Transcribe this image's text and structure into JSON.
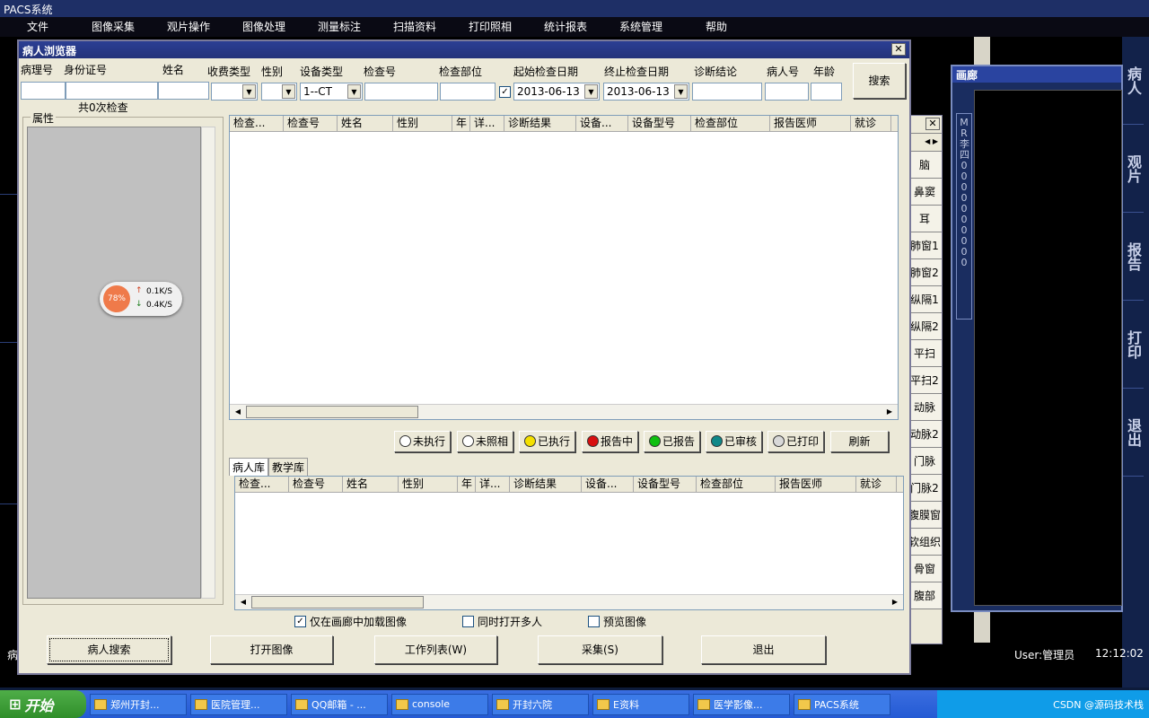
{
  "app_title": "PACS系统",
  "menu": [
    "文件",
    "图像采集",
    "观片操作",
    "图像处理",
    "测量标注",
    "扫描资料",
    "打印照相",
    "统计报表",
    "系统管理",
    "帮助"
  ],
  "right_panel": [
    "病人",
    "观片",
    "报告",
    "打印",
    "退出"
  ],
  "status": {
    "user": "User:管理员",
    "time": "12:12:02",
    "fragment": "病"
  },
  "gallery": {
    "title": "画廊",
    "vertical_text": "MR李四0000000000"
  },
  "side_items": [
    "脑",
    "鼻窦",
    "耳",
    "肺窗1",
    "肺窗2",
    "纵隔1",
    "纵隔2",
    "平扫",
    "平扫2",
    "动脉",
    "动脉2",
    "门脉",
    "门脉2",
    "腹膜窗",
    "软组织",
    "骨窗",
    "腹部"
  ],
  "dialog": {
    "title": "病人浏览器",
    "fields": {
      "pathology_no": "病理号",
      "id_no": "身份证号",
      "name": "姓名",
      "fee_type": "收费类型",
      "gender": "性别",
      "device_type": "设备类型",
      "device_value": "1--CT",
      "exam_no": "检查号",
      "exam_part": "检查部位",
      "start_date_label": "起始检查日期",
      "start_date": "2013-06-13",
      "end_date_label": "终止检查日期",
      "end_date": "2013-06-13",
      "diagnosis": "诊断结论",
      "patient_no": "病人号",
      "age": "年龄"
    },
    "search_button": "搜索",
    "count_text": "共0次检查",
    "property_label": "属性",
    "columns": [
      "检查...",
      "检查号",
      "姓名",
      "性别",
      "年",
      "详...",
      "诊断结果",
      "设备...",
      "设备型号",
      "检查部位",
      "报告医师",
      "就诊"
    ],
    "status_buttons": [
      {
        "label": "未执行",
        "color": "#ffffff"
      },
      {
        "label": "未照相",
        "color": "#ffffff"
      },
      {
        "label": "已执行",
        "color": "#f4e000"
      },
      {
        "label": "报告中",
        "color": "#d81010"
      },
      {
        "label": "已报告",
        "color": "#10c010"
      },
      {
        "label": "已审核",
        "color": "#108888"
      },
      {
        "label": "已打印",
        "color": "#d8d8d8"
      }
    ],
    "refresh": "刷新",
    "tabs": [
      "病人库",
      "教学库"
    ],
    "options": [
      {
        "label": "仅在画廊中加载图像",
        "checked": "✓"
      },
      {
        "label": "同时打开多人",
        "checked": ""
      },
      {
        "label": "预览图像",
        "checked": ""
      }
    ],
    "bottom_buttons": [
      "病人搜索",
      "打开图像",
      "工作列表(W)",
      "采集(S)",
      "退出"
    ]
  },
  "network_widget": {
    "percent": "78%",
    "up": "0.1K/S",
    "down": "0.4K/S"
  },
  "taskbar": {
    "start": "开始",
    "items": [
      "郑州开封...",
      "医院管理...",
      "QQ邮箱 - ...",
      "console",
      "开封六院",
      "E资料",
      "医学影像...",
      "PACS系统"
    ],
    "tray_text": "CSDN @源码技术栈"
  },
  "colors": {
    "title_bar": "#2c3f94",
    "desktop": "#000000",
    "taskbar": "#245ad4"
  }
}
